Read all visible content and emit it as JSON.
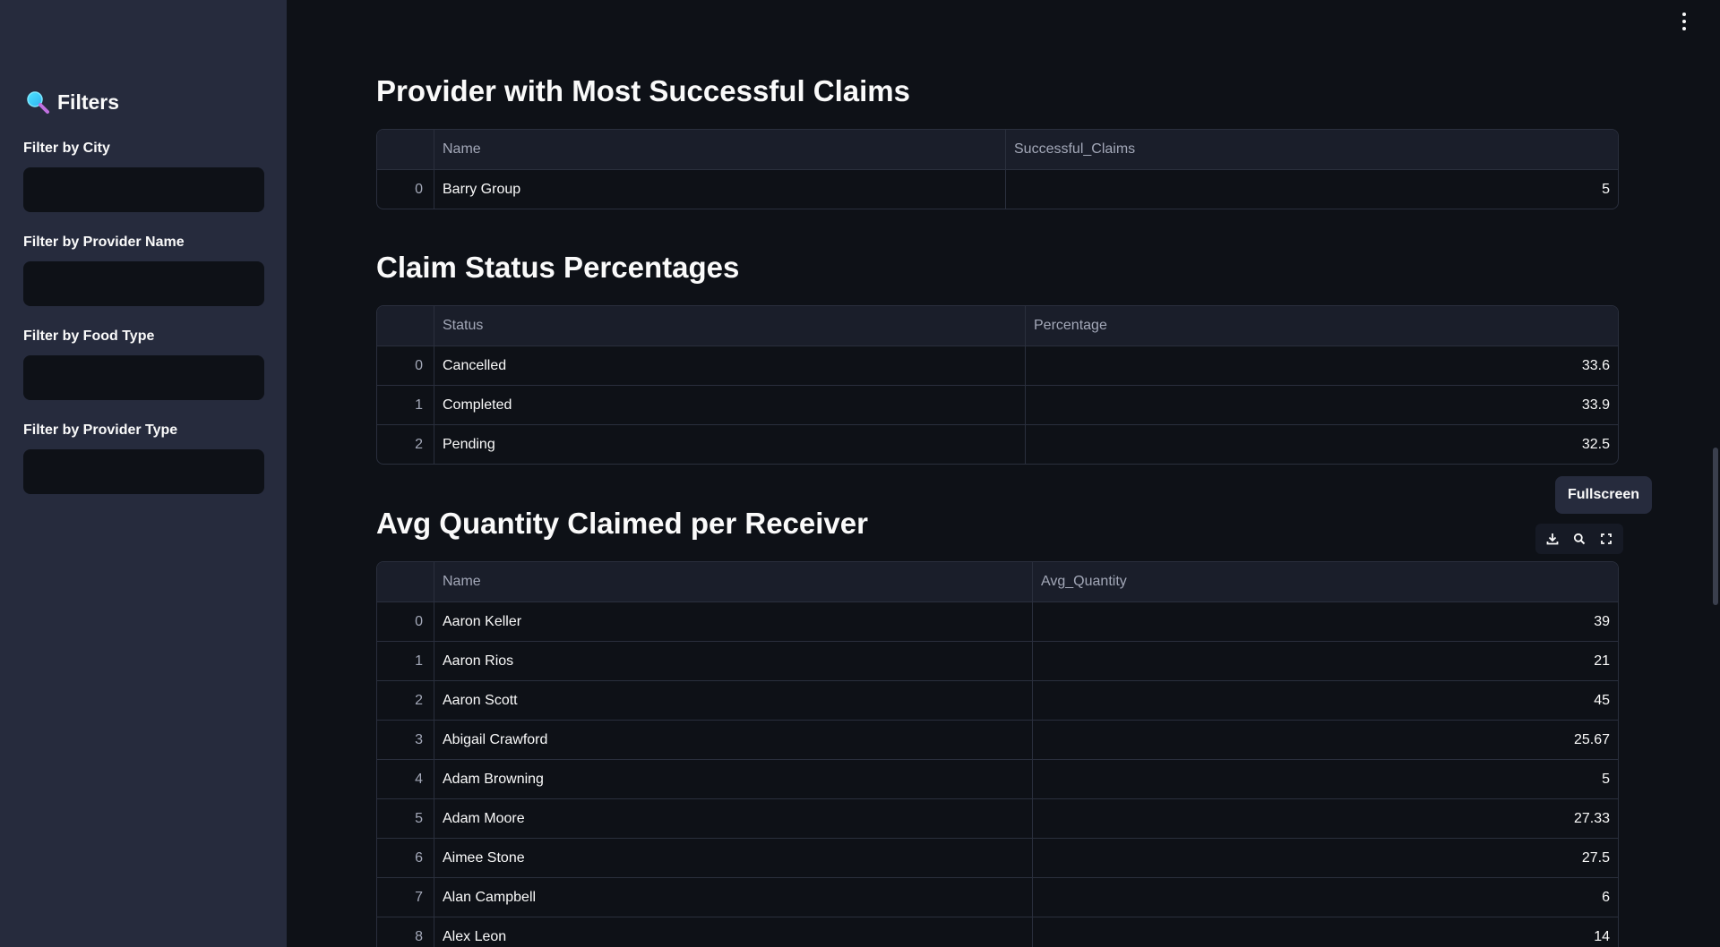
{
  "sidebar": {
    "title": "Filters",
    "filters": [
      {
        "label": "Filter by City",
        "value": ""
      },
      {
        "label": "Filter by Provider Name",
        "value": ""
      },
      {
        "label": "Filter by Food Type",
        "value": ""
      },
      {
        "label": "Filter by Provider Type",
        "value": ""
      }
    ]
  },
  "sections": {
    "top_provider": {
      "title": "Provider with Most Successful Claims",
      "columns": [
        "Name",
        "Successful_Claims"
      ],
      "rows": [
        {
          "index": "0",
          "c1": "Barry Group",
          "c2": "5"
        }
      ]
    },
    "claim_status": {
      "title": "Claim Status Percentages",
      "columns": [
        "Status",
        "Percentage"
      ],
      "rows": [
        {
          "index": "0",
          "c1": "Cancelled",
          "c2": "33.6"
        },
        {
          "index": "1",
          "c1": "Completed",
          "c2": "33.9"
        },
        {
          "index": "2",
          "c1": "Pending",
          "c2": "32.5"
        }
      ]
    },
    "avg_quantity": {
      "title": "Avg Quantity Claimed per Receiver",
      "columns": [
        "Name",
        "Avg_Quantity"
      ],
      "rows": [
        {
          "index": "0",
          "c1": "Aaron Keller",
          "c2": "39"
        },
        {
          "index": "1",
          "c1": "Aaron Rios",
          "c2": "21"
        },
        {
          "index": "2",
          "c1": "Aaron Scott",
          "c2": "45"
        },
        {
          "index": "3",
          "c1": "Abigail Crawford",
          "c2": "25.67"
        },
        {
          "index": "4",
          "c1": "Adam Browning",
          "c2": "5"
        },
        {
          "index": "5",
          "c1": "Adam Moore",
          "c2": "27.33"
        },
        {
          "index": "6",
          "c1": "Aimee Stone",
          "c2": "27.5"
        },
        {
          "index": "7",
          "c1": "Alan Campbell",
          "c2": "6"
        },
        {
          "index": "8",
          "c1": "Alex Leon",
          "c2": "14"
        }
      ]
    }
  },
  "tooltip": {
    "label": "Fullscreen"
  },
  "toolbar": {
    "icons": [
      "download-icon",
      "search-icon",
      "fullscreen-icon"
    ]
  },
  "colors": {
    "background": "#0e1117",
    "sidebar": "#262b3d",
    "text": "#fafafa",
    "muted": "#a3a8b8",
    "border": "#2a2f3d"
  }
}
